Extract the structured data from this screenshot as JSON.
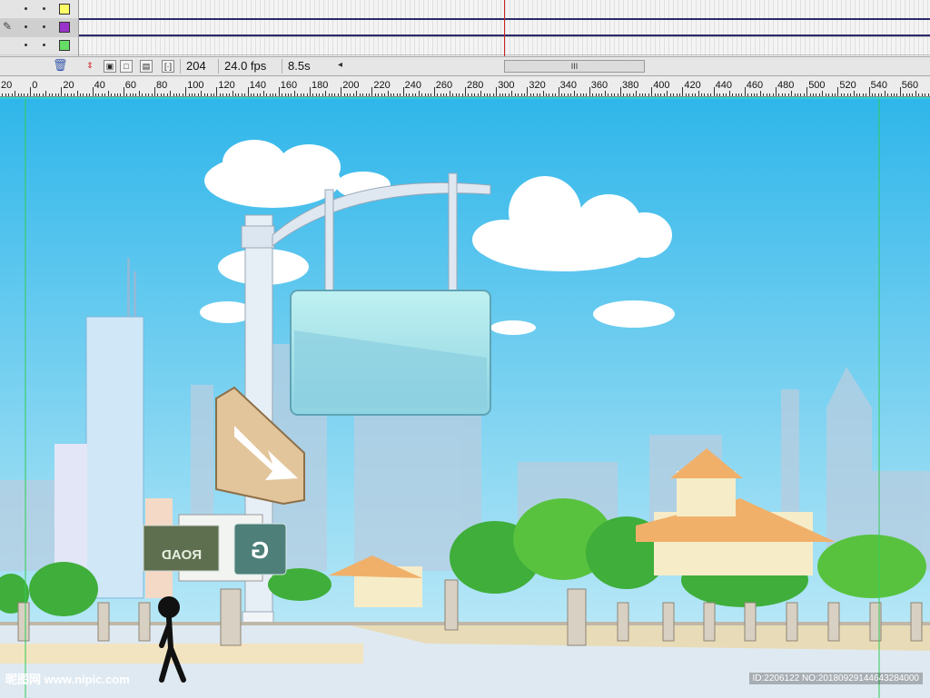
{
  "timeline": {
    "layers": [
      {
        "swatch_color": "#ffff66",
        "selected": false
      },
      {
        "swatch_color": "#9933cc",
        "selected": true
      },
      {
        "swatch_color": "#66dd66",
        "selected": false
      }
    ],
    "current_frame": "204",
    "frame_rate": "24.0 fps",
    "elapsed_time": "8.5s",
    "scrollbar_grip": "III"
  },
  "ruler": {
    "labels": [
      "20",
      "0",
      "20",
      "40",
      "60",
      "80",
      "100",
      "120",
      "140",
      "160",
      "180",
      "200",
      "220",
      "240",
      "260",
      "280",
      "300",
      "320",
      "340",
      "360",
      "380",
      "400",
      "420",
      "440",
      "460",
      "480",
      "500",
      "520",
      "540",
      "560"
    ]
  },
  "stage": {
    "street_sign_text": "ROAD",
    "g_sign_text": "G",
    "sky_top": "#2fb6ea",
    "sky_bottom": "#bfeaf7"
  },
  "watermark": {
    "site": "昵图网 www.nipic.com",
    "id_text": "ID:2206122 NO:20180929144643284000"
  }
}
